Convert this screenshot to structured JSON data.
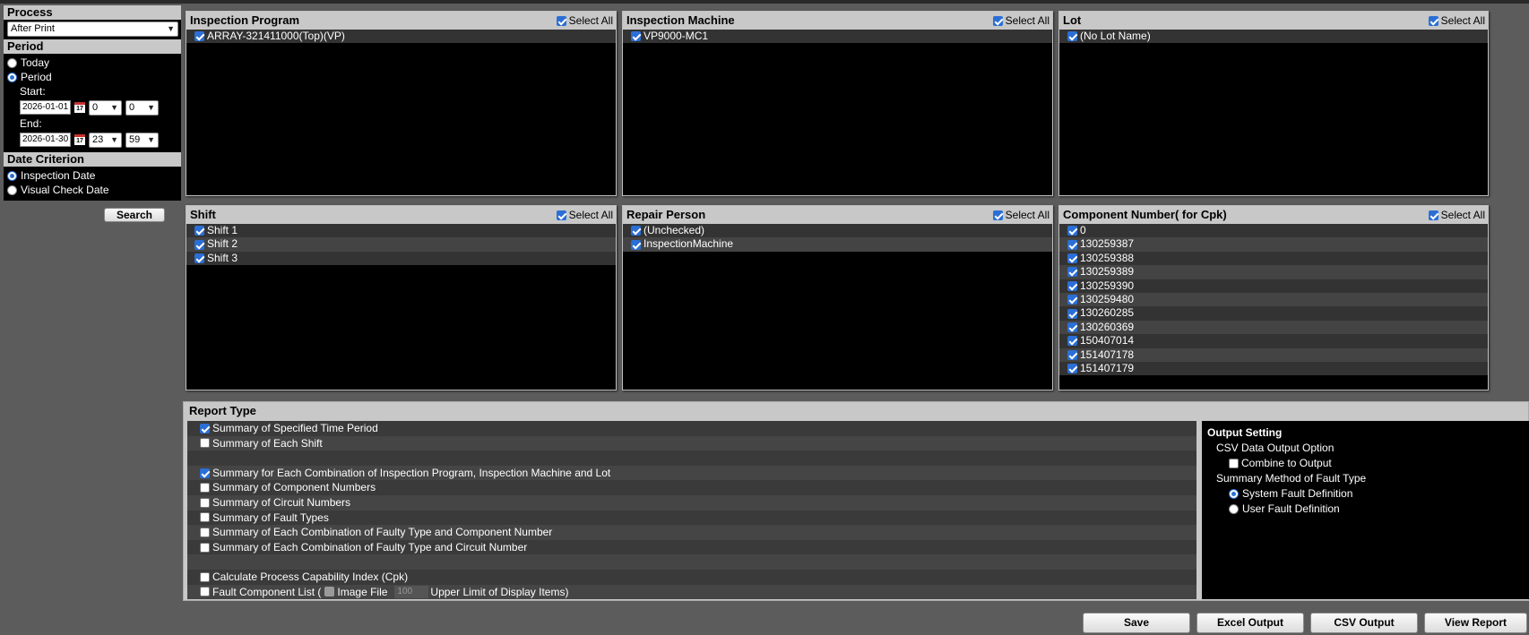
{
  "process": {
    "title": "Process",
    "selected": "After Print"
  },
  "period": {
    "title": "Period",
    "options": [
      {
        "label": "Today",
        "checked": false
      },
      {
        "label": "Period",
        "checked": true
      }
    ],
    "start_label": "Start:",
    "start_date": "2026-01-01",
    "start_hour": "0",
    "start_minute": "0",
    "end_label": "End:",
    "end_date": "2026-01-30",
    "end_hour": "23",
    "end_minute": "59",
    "calendar_icon": "calendar-icon",
    "calendar_text": "17"
  },
  "date_criterion": {
    "title": "Date Criterion",
    "options": [
      {
        "label": "Inspection Date",
        "checked": true
      },
      {
        "label": "Visual Check Date",
        "checked": false
      }
    ]
  },
  "search_label": "Search",
  "select_all_label": "Select All",
  "panels": {
    "inspection_program": {
      "title": "Inspection Program",
      "items": [
        "ARRAY-321411000(Top)(VP)"
      ]
    },
    "inspection_machine": {
      "title": "Inspection Machine",
      "items": [
        "VP9000-MC1"
      ]
    },
    "lot": {
      "title": "Lot",
      "items": [
        "(No Lot Name)"
      ]
    },
    "shift": {
      "title": "Shift",
      "items": [
        "Shift 1",
        "Shift 2",
        "Shift 3"
      ]
    },
    "repair_person": {
      "title": "Repair Person",
      "items": [
        "(Unchecked)",
        "InspectionMachine"
      ]
    },
    "component_number": {
      "title": "Component Number( for Cpk)",
      "items": [
        "0",
        "130259387",
        "130259388",
        "130259389",
        "130259390",
        "130259480",
        "130260285",
        "130260369",
        "150407014",
        "151407178",
        "151407179"
      ]
    }
  },
  "report_type": {
    "title": "Report Type",
    "items": [
      {
        "label": "Summary of Specified Time Period",
        "checked": true
      },
      {
        "label": "Summary of Each Shift",
        "checked": false
      },
      null,
      {
        "label": "Summary for Each Combination of Inspection Program, Inspection Machine and Lot",
        "checked": true
      },
      {
        "label": "Summary of Component Numbers",
        "checked": false
      },
      {
        "label": "Summary of Circuit Numbers",
        "checked": false
      },
      {
        "label": "Summary of Fault Types",
        "checked": false
      },
      {
        "label": "Summary of Each Combination of Faulty Type and Component Number",
        "checked": false
      },
      {
        "label": "Summary of Each Combination of Faulty Type and Circuit Number",
        "checked": false
      },
      null,
      {
        "label": "Calculate Process Capability Index (Cpk)",
        "checked": false
      }
    ],
    "fault_list_label": "Fault Component List (",
    "image_file_label": "Image File",
    "limit_value": "100",
    "limit_label": "Upper Limit of Display Items)"
  },
  "output_setting": {
    "title": "Output Setting",
    "csv_title": "CSV Data Output Option",
    "combine_label": "Combine to Output",
    "fault_method_title": "Summary Method of Fault Type",
    "fault_options": [
      {
        "label": "System Fault Definition",
        "checked": true
      },
      {
        "label": "User Fault Definition",
        "checked": false
      }
    ]
  },
  "buttons": {
    "save": "Save",
    "excel": "Excel Output",
    "csv": "CSV Output",
    "view": "View Report"
  }
}
